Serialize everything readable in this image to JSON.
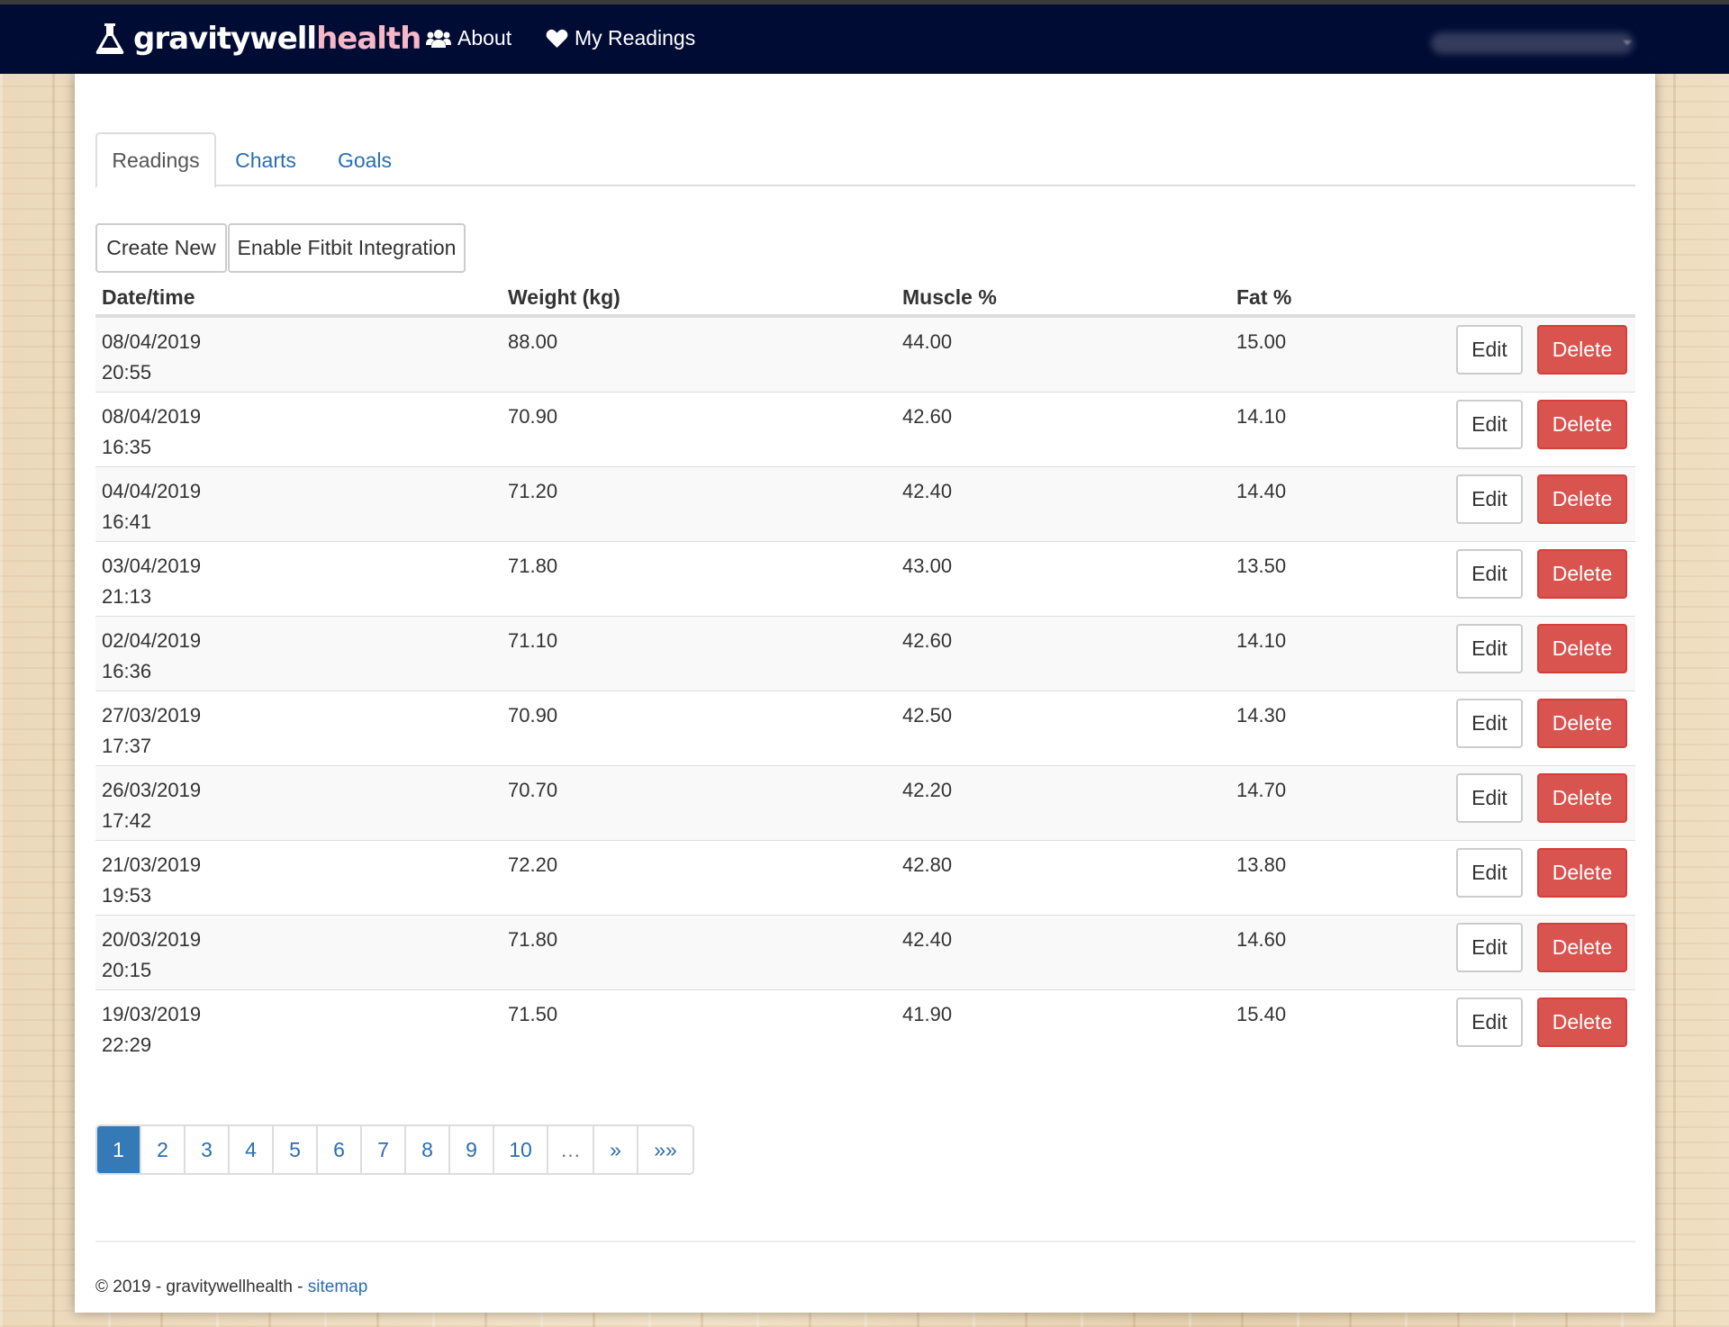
{
  "brand": {
    "part1": "gravitywell",
    "part2": "health",
    "logo_icon": "flask-icon",
    "color_part2": "#f6b7c7"
  },
  "nav": {
    "about": {
      "label": "About",
      "icon": "users-icon"
    },
    "my_readings": {
      "label": "My Readings",
      "icon": "heart-icon"
    }
  },
  "tabs": [
    "Readings",
    "Charts",
    "Goals"
  ],
  "toolbar": {
    "create_new": "Create New",
    "fitbit": "Enable Fitbit Integration"
  },
  "table": {
    "headers": [
      "Date/time",
      "Weight (kg)",
      "Muscle %",
      "Fat %"
    ],
    "edit_label": "Edit",
    "delete_label": "Delete",
    "rows": [
      {
        "date": "08/04/2019",
        "time": "20:55",
        "weight": "88.00",
        "muscle": "44.00",
        "fat": "15.00"
      },
      {
        "date": "08/04/2019",
        "time": "16:35",
        "weight": "70.90",
        "muscle": "42.60",
        "fat": "14.10"
      },
      {
        "date": "04/04/2019",
        "time": "16:41",
        "weight": "71.20",
        "muscle": "42.40",
        "fat": "14.40"
      },
      {
        "date": "03/04/2019",
        "time": "21:13",
        "weight": "71.80",
        "muscle": "43.00",
        "fat": "13.50"
      },
      {
        "date": "02/04/2019",
        "time": "16:36",
        "weight": "71.10",
        "muscle": "42.60",
        "fat": "14.10"
      },
      {
        "date": "27/03/2019",
        "time": "17:37",
        "weight": "70.90",
        "muscle": "42.50",
        "fat": "14.30"
      },
      {
        "date": "26/03/2019",
        "time": "17:42",
        "weight": "70.70",
        "muscle": "42.20",
        "fat": "14.70"
      },
      {
        "date": "21/03/2019",
        "time": "19:53",
        "weight": "72.20",
        "muscle": "42.80",
        "fat": "13.80"
      },
      {
        "date": "20/03/2019",
        "time": "20:15",
        "weight": "71.80",
        "muscle": "42.40",
        "fat": "14.60"
      },
      {
        "date": "19/03/2019",
        "time": "22:29",
        "weight": "71.50",
        "muscle": "41.90",
        "fat": "15.40"
      }
    ]
  },
  "pagination": [
    "1",
    "2",
    "3",
    "4",
    "5",
    "6",
    "7",
    "8",
    "9",
    "10",
    "…",
    "»",
    "»»"
  ],
  "pagination_active": "1",
  "footer": {
    "text": "© 2019 - gravitywellhealth - ",
    "link": "sitemap"
  },
  "colors": {
    "navbar": "#010c35",
    "link": "#2a6eb3",
    "danger": "#d9534f",
    "active_page": "#337ab7"
  }
}
